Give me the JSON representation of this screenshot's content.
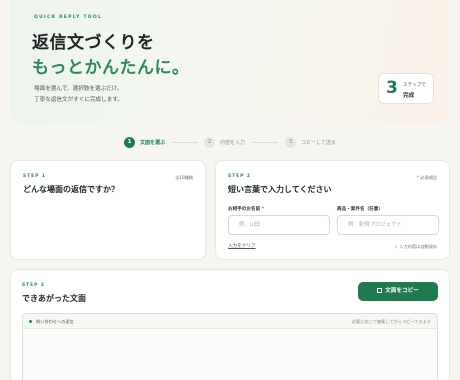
{
  "hero": {
    "eyebrow": "QUICK REPLY TOOL",
    "title_line1": "返信文づくりを",
    "title_line2": "もっとかんたんに。",
    "subtitle_line1": "場面を選んで、選択肢を選ぶだけ。",
    "subtitle_line2": "丁寧な返信文がすぐに完成します。",
    "steps_count": "3",
    "steps_caption1": "ステップで",
    "steps_caption2": "完成"
  },
  "stepper": [
    {
      "num": "1",
      "label": "文面を選ぶ",
      "active": true
    },
    {
      "num": "2",
      "label": "内容を入力",
      "active": false
    },
    {
      "num": "3",
      "label": "コピーして送る",
      "active": false
    }
  ],
  "step1": {
    "label": "STEP 1",
    "title": "どんな場面の返信ですか？",
    "meta": "全10種類"
  },
  "step2": {
    "label": "STEP 2",
    "title": "短い言葉で入力してください",
    "meta": "* 必須項目",
    "field_name_label": "お相手のお名前",
    "field_name_required": "*",
    "field_name_placeholder": "例：山田",
    "field_project_label": "商品・案件名（任意）",
    "field_project_placeholder": "例：新規プロジェクト",
    "clear_label": "入力をクリア",
    "autosave_label": "入力内容は自動保存"
  },
  "step3": {
    "label": "STEP 3",
    "title": "できあがった文面",
    "copy_label": "文面をコピー",
    "output_header_left": "問い合わせへの返信",
    "output_header_right": "必要に応じて編集してからコピーできます"
  },
  "colors": {
    "accent": "#1f7a4f",
    "accent_light": "#2e8a5c",
    "background": "#f6f5f1"
  }
}
